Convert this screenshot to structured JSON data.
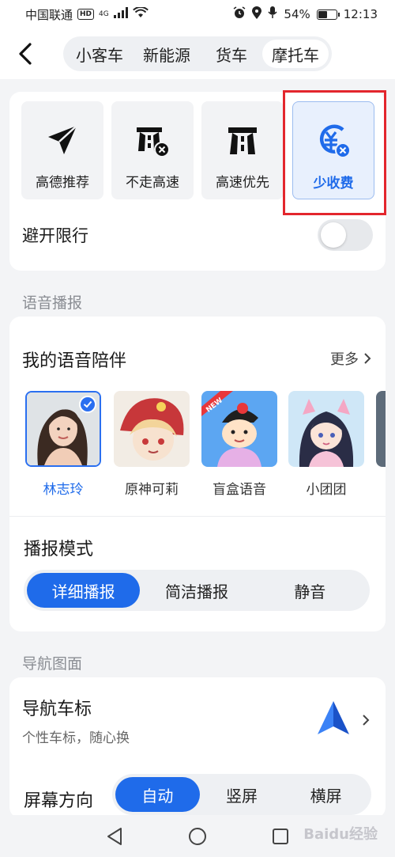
{
  "status_bar": {
    "carrier": "中国联通",
    "hd": "HD",
    "network": "4G",
    "battery": "54%",
    "battery_level": 0.54,
    "time": "12:13"
  },
  "header": {
    "tabs": [
      {
        "label": "小客车"
      },
      {
        "label": "新能源"
      },
      {
        "label": "货车"
      },
      {
        "label": "摩托车"
      }
    ],
    "active_tab": "摩托车"
  },
  "route_options": {
    "items": [
      {
        "label": "高德推荐",
        "icon": "send-arrow-icon"
      },
      {
        "label": "不走高速",
        "icon": "no-highway-icon"
      },
      {
        "label": "高速优先",
        "icon": "highway-icon"
      },
      {
        "label": "少收费",
        "icon": "less-toll-icon"
      }
    ],
    "selected": "少收费",
    "avoid_restriction_label": "避开限行",
    "avoid_restriction_on": false
  },
  "voice_section": {
    "title": "语音播报",
    "companion_title": "我的语音陪伴",
    "more_label": "更多",
    "voices": [
      {
        "name": "林志玲"
      },
      {
        "name": "原神可莉"
      },
      {
        "name": "盲盒语音"
      },
      {
        "name": "小团团"
      }
    ],
    "selected_voice": "林志玲",
    "new_badge": "NEW",
    "mode_title": "播报模式",
    "modes": [
      "详细播报",
      "简洁播报",
      "静音"
    ],
    "active_mode": "详细播报"
  },
  "nav_section": {
    "title": "导航图面",
    "car_icon_title": "导航车标",
    "car_icon_subtitle": "个性车标，随心换",
    "orientation_label": "屏幕方向",
    "orientations": [
      "自动",
      "竖屏",
      "横屏"
    ],
    "active_orientation": "自动"
  },
  "watermark": "Baidu经验",
  "colors": {
    "accent": "#1f6bea",
    "highlight_box": "#e3262d",
    "page_bg": "#f3f4f6"
  }
}
